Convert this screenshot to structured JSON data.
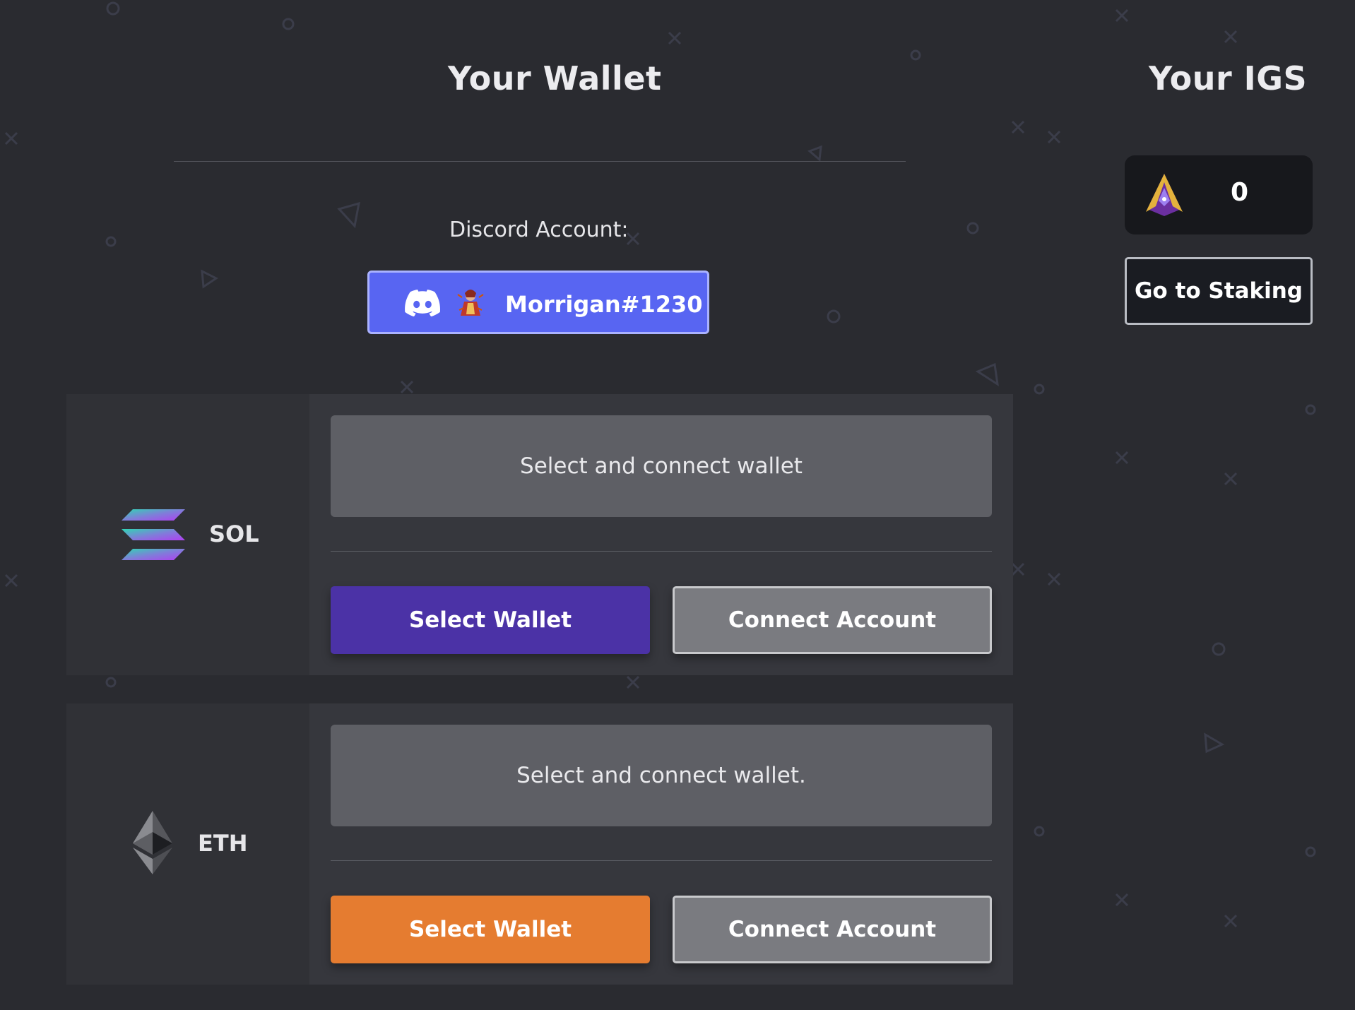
{
  "wallet": {
    "title": "Your Wallet",
    "discord_label": "Discord Account:",
    "discord_username": "Morrigan#1230"
  },
  "chains": {
    "sol": {
      "name": "SOL",
      "status": "Select and connect wallet",
      "select_label": "Select Wallet",
      "connect_label": "Connect Account",
      "select_color": "#4b32a6"
    },
    "eth": {
      "name": "ETH",
      "status": "Select and connect wallet.",
      "select_label": "Select Wallet",
      "connect_label": "Connect Account",
      "select_color": "#e57c30"
    }
  },
  "igs": {
    "title": "Your IGS",
    "balance": "0",
    "staking_label": "Go to Staking"
  },
  "colors": {
    "background": "#2a2b30",
    "discord_blurple": "#5865f2"
  },
  "icons": {
    "discord": "discord-icon",
    "avatar": "avatar",
    "sol": "solana-logo-icon",
    "eth": "ethereum-logo-icon",
    "igs_token": "igs-token-icon"
  }
}
